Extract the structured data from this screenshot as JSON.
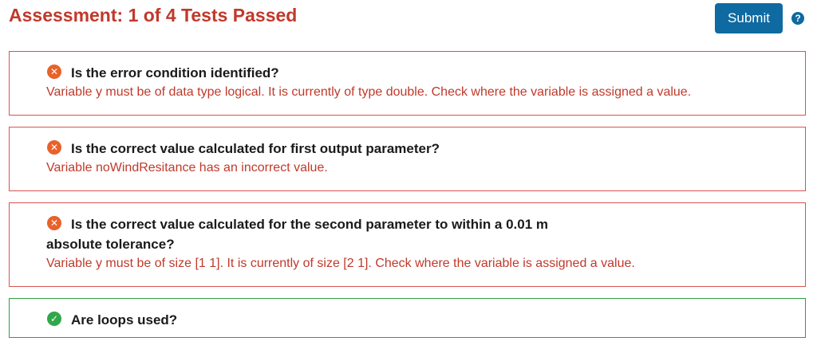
{
  "header": {
    "title": "Assessment: 1 of 4 Tests Passed",
    "submit_label": "Submit",
    "help_glyph": "?"
  },
  "colors": {
    "title_red": "#c0392b",
    "fail_border": "#d9534f",
    "fail_icon": "#e8622a",
    "pass_border": "#2e9e46",
    "pass_icon": "#2ea84a",
    "button_blue": "#0e6aa0"
  },
  "tests": [
    {
      "status": "fail",
      "icon": "x-circle-icon",
      "question": "Is the error condition identified?",
      "feedback": "Variable y must be of data type logical. It is currently of type double. Check where the variable is assigned a value."
    },
    {
      "status": "fail",
      "icon": "x-circle-icon",
      "question": "Is the correct value calculated for first output parameter?",
      "feedback": "Variable noWindResitance has an incorrect value."
    },
    {
      "status": "fail",
      "icon": "x-circle-icon",
      "question_line1": "Is the correct value calculated for the second parameter to within a 0.01 m",
      "question_line2": "absolute tolerance?",
      "feedback": "Variable y must be of size [1 1]. It is currently of size [2 1]. Check where the variable is assigned a value."
    },
    {
      "status": "pass",
      "icon": "check-circle-icon",
      "question": "Are loops used?"
    }
  ]
}
